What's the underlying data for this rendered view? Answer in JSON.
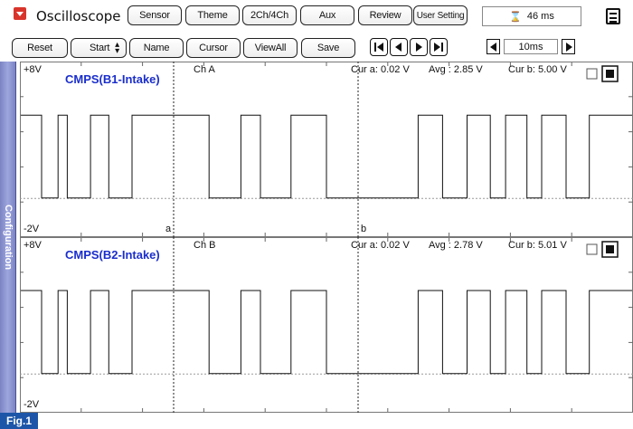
{
  "app": {
    "title": "Oscilloscope",
    "menu_icon": "dropdown-menu-icon"
  },
  "toolbar": {
    "sensor": "Sensor",
    "theme": "Theme",
    "channels": "2Ch/4Ch",
    "aux": "Aux",
    "review": "Review",
    "user_setting": "User Setting",
    "record_time": "46 ms",
    "reset": "Reset",
    "start": "Start",
    "name": "Name",
    "cursor": "Cursor",
    "view_all": "ViewAll",
    "save": "Save",
    "time_div": "10ms"
  },
  "side_panel": {
    "label": "Configuration"
  },
  "colors": {
    "signal": "#111111",
    "channel_name": "#1a2ecc",
    "side_panel": "#8a92cf",
    "fig_label": "#1d56a8",
    "grid": "#9a9a9a"
  },
  "cursors": {
    "a_label": "a",
    "b_label": "b"
  },
  "channels": [
    {
      "name": "CMPS(B1-Intake)",
      "channel": "Ch A",
      "y_max_label": "+8V",
      "y_min_label": "-2V",
      "cur_a": "Cur a: 0.02 V",
      "avg": "Avg  : 2.85 V",
      "cur_b": "Cur b: 5.00 V",
      "ylim": [
        -2,
        8
      ],
      "high": 5.0,
      "low": 0.02,
      "transitions": [
        0.034,
        0.061,
        0.076,
        0.114,
        0.144,
        0.182,
        0.308,
        0.36,
        0.392,
        0.442,
        0.5,
        0.65,
        0.69,
        0.73,
        0.768,
        0.793,
        0.828,
        0.852,
        0.892,
        0.93
      ],
      "high_first": true
    },
    {
      "name": "CMPS(B2-Intake)",
      "channel": "Ch B",
      "y_max_label": "+8V",
      "y_min_label": "-2V",
      "cur_a": "Cur a: 0.02 V",
      "avg": "Avg  : 2.78 V",
      "cur_b": "Cur b: 5.01 V",
      "ylim": [
        -2,
        8
      ],
      "high": 5.01,
      "low": 0.02,
      "transitions": [
        0.034,
        0.061,
        0.076,
        0.114,
        0.144,
        0.182,
        0.308,
        0.36,
        0.392,
        0.442,
        0.5,
        0.65,
        0.69,
        0.73,
        0.768,
        0.793,
        0.828,
        0.852,
        0.892,
        0.93
      ],
      "high_first": true
    }
  ],
  "figure": {
    "label": "Fig.1"
  }
}
